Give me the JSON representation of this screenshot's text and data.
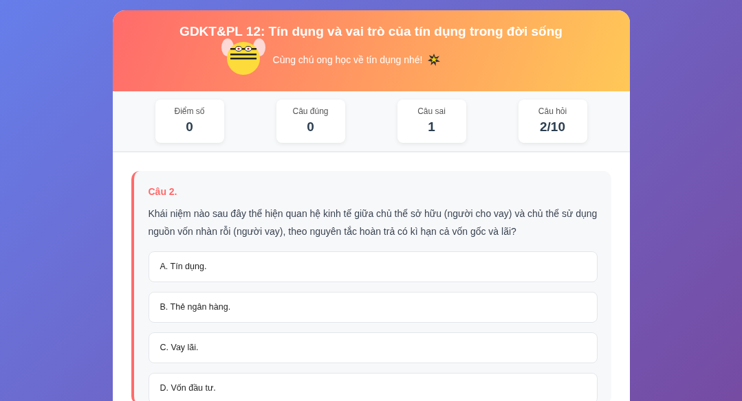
{
  "header": {
    "title": "GDKT&PL 12: Tín dụng và vai trò của tín dụng trong đời sống",
    "subtitle": "Cùng chú ong học về tín dụng nhé!"
  },
  "stats": [
    {
      "label": "Điểm số",
      "value": "0"
    },
    {
      "label": "Câu đúng",
      "value": "0"
    },
    {
      "label": "Câu sai",
      "value": "1"
    },
    {
      "label": "Câu hỏi",
      "value": "2/10"
    }
  ],
  "question": {
    "number": "Câu 2.",
    "text": "Khái niệm nào sau đây thể hiện quan hệ kinh tế giữa chủ thể sở hữu (người cho vay) và chủ thể sử dụng nguồn vốn nhàn rỗi (người vay), theo nguyên tắc hoàn trả có kì hạn cả vốn gốc và lãi?",
    "options": [
      {
        "label": "A. Tín dụng.",
        "selected": false
      },
      {
        "label": "B. Thẻ ngân hàng.",
        "selected": false
      },
      {
        "label": "C. Vay lãi.",
        "selected": false
      },
      {
        "label": "D. Vốn đầu tư.",
        "selected": false
      }
    ]
  }
}
